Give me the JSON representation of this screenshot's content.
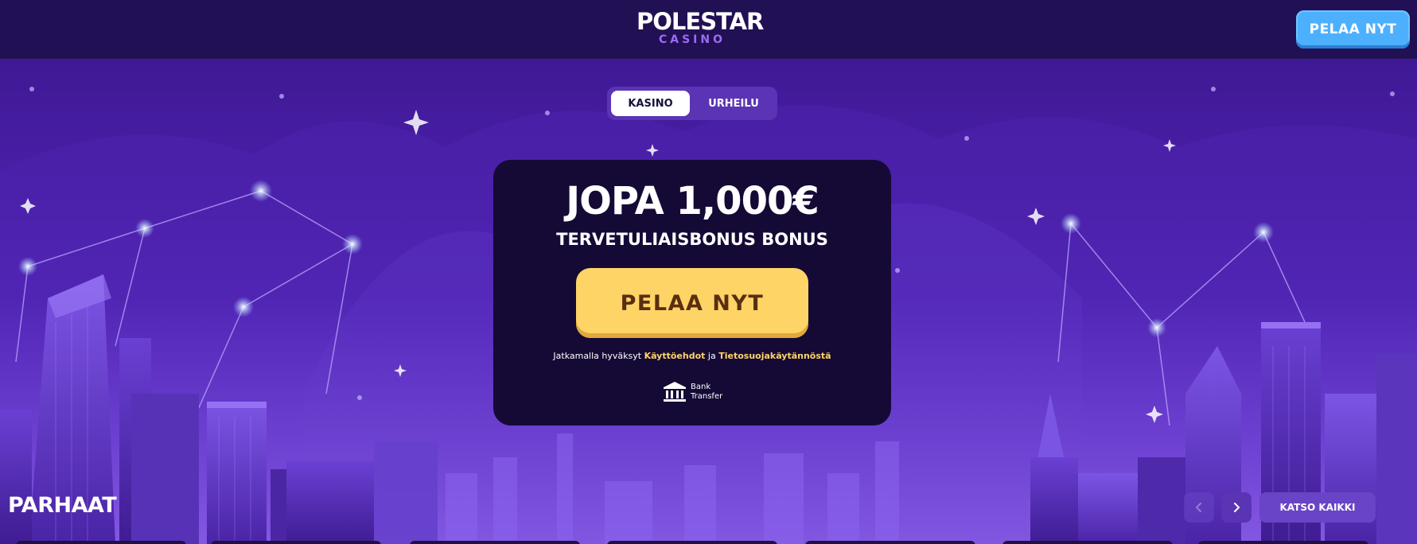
{
  "header": {
    "logo_main": "POLESTAR",
    "logo_sub": "CASINO",
    "cta_label": "PELAA NYT"
  },
  "toggle": {
    "options": [
      {
        "label": "KASINO",
        "active": true
      },
      {
        "label": "URHEILU",
        "active": false
      }
    ]
  },
  "bonus": {
    "amount": "JOPA 1,000€",
    "subtitle": "TERVETULIAISBONUS BONUS",
    "cta_label": "PELAA NYT",
    "terms_prefix": "Jatkamalla hyväksyt",
    "terms_link": "Käyttöehdot",
    "terms_joiner": "ja",
    "privacy_link": "Tietosuojakäytännöstä",
    "payment_method": {
      "icon": "bank-icon",
      "line1": "Bank",
      "line2": "Transfer"
    }
  },
  "games": {
    "section_title": "PARHAAT",
    "prev_icon": "chevron-left-icon",
    "next_icon": "chevron-right-icon",
    "see_all_label": "KATSO KAIKKI"
  },
  "colors": {
    "header_bg": "#221055",
    "card_bg": "#150a36",
    "accent_yellow": "#ffd466",
    "accent_blue": "#4cb0ff",
    "purple": "#5a34b4"
  }
}
